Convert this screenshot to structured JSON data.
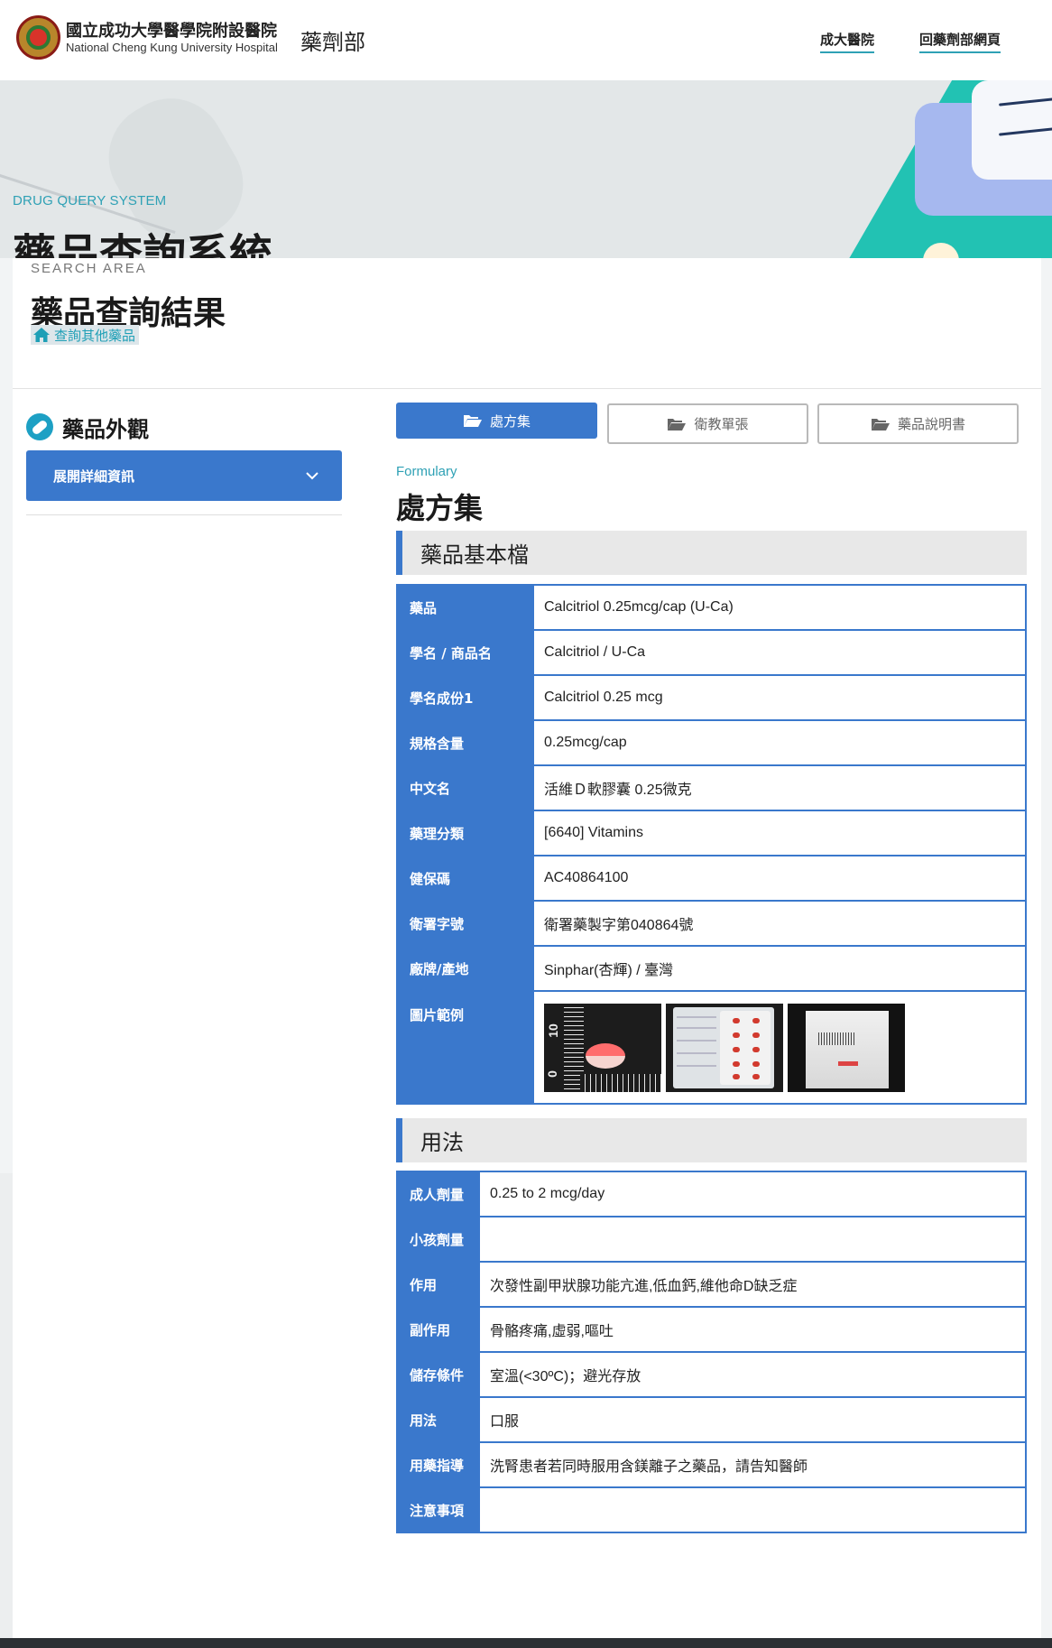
{
  "header": {
    "logo_cn": "國立成功大學醫學院附設醫院",
    "logo_en": "National Cheng Kung University Hospital",
    "dept": "藥劑部",
    "nav": [
      "成大醫院",
      "回藥劑部網頁"
    ]
  },
  "hero": {
    "tag": "DRUG QUERY SYSTEM",
    "title": "藥品查詢系統"
  },
  "search": {
    "tag": "SEARCH AREA",
    "title": "藥品查詢結果",
    "back_link": "查詢其他藥品"
  },
  "appearance": {
    "title": "藥品外觀",
    "expand_label": "展開詳細資訊"
  },
  "tabs": [
    {
      "label": "處方集",
      "active": true
    },
    {
      "label": "衛教單張",
      "active": false
    },
    {
      "label": "藥品說明書",
      "active": false
    }
  ],
  "formulary": {
    "tag": "Formulary",
    "title": "處方集"
  },
  "basic": {
    "heading": "藥品基本檔",
    "rows": [
      {
        "label": "藥品",
        "value": "Calcitriol 0.25mcg/cap (U-Ca)"
      },
      {
        "label": "學名 / 商品名",
        "value": "Calcitriol / U-Ca"
      },
      {
        "label": "學名成份1",
        "value": "Calcitriol 0.25 mcg"
      },
      {
        "label": "規格含量",
        "value": "0.25mcg/cap"
      },
      {
        "label": "中文名",
        "value": "活維Ｄ軟膠囊 0.25微克"
      },
      {
        "label": "藥理分類",
        "value": "[6640] Vitamins"
      },
      {
        "label": "健保碼",
        "value": "AC40864100"
      },
      {
        "label": "衛署字號",
        "value": "衛署藥製字第040864號"
      },
      {
        "label": "廠牌/產地",
        "value": "Sinphar(杏輝) / 臺灣"
      },
      {
        "label": "圖片範例",
        "value": ""
      }
    ],
    "photo_ruler_numbers": [
      "10",
      "0"
    ]
  },
  "usage": {
    "heading": "用法",
    "rows": [
      {
        "label": "成人劑量",
        "value": "0.25 to 2 mcg/day"
      },
      {
        "label": "小孩劑量",
        "value": ""
      },
      {
        "label": "作用",
        "value": "次發性副甲狀腺功能亢進,低血鈣,維他命D缺乏症"
      },
      {
        "label": "副作用",
        "value": "骨骼疼痛,虛弱,嘔吐"
      },
      {
        "label": "儲存條件",
        "value": "室溫(<30ºC)；避光存放"
      },
      {
        "label": "用法",
        "value": "口服"
      },
      {
        "label": "用藥指導",
        "value": "洗腎患者若同時服用含鎂離子之藥品，請告知醫師"
      },
      {
        "label": "注意事項",
        "value": ""
      }
    ]
  },
  "colors": {
    "accent_blue": "#3a78cc",
    "teal": "#2fa1b5",
    "hero_teal": "#22c2b3"
  }
}
